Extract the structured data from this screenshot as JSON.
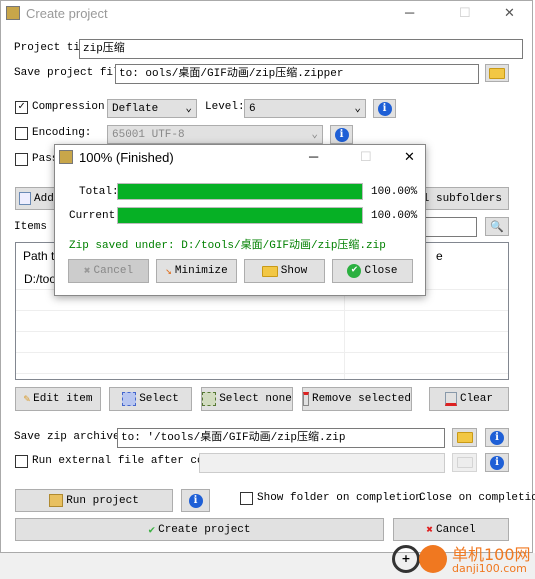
{
  "window": {
    "title": "Create project",
    "minimize": "─",
    "maximize": "☐",
    "close": "✕"
  },
  "form": {
    "project_title_label": "Project tit",
    "project_title_value": "zip压缩",
    "save_project_label": "Save project file",
    "save_project_value": "to: ools/桌面/GIF动画/zip压缩.zipper",
    "compression_label": "Compression:",
    "compression_checked": true,
    "compression_value": "Deflate",
    "level_label": "Level:",
    "level_value": "6",
    "encoding_label": "Encoding:",
    "encoding_checked": false,
    "encoding_value": "65001 UTF-8",
    "password_label": "Pass",
    "add_button": "Add",
    "subfolders_button": "l subfolders",
    "items_label": "Items i",
    "table": {
      "columns": [
        "Path to",
        "e"
      ],
      "rows": [
        [
          "D:/tool",
          ""
        ]
      ]
    },
    "edit_item": "Edit item",
    "select": "Select",
    "select_none": "Select none",
    "remove_selected": "Remove selected",
    "clear": "Clear",
    "save_zip_label": "Save zip archive",
    "save_zip_value": "to: '/tools/桌面/GIF动画/zip压缩.zip",
    "run_external_label": "Run external file after completion:",
    "run_external_checked": false,
    "run_project": "Run project",
    "show_folder_label": "Show folder on completion",
    "close_on_completion_label": "Close on completion",
    "create_project": "Create project",
    "cancel": "Cancel"
  },
  "dialog": {
    "title": "100% (Finished)",
    "minimize": "─",
    "maximize": "☐",
    "close": "✕",
    "total_label": "Total:",
    "total_percent": "100.00%",
    "total_progress": 100,
    "current_label": "Current:",
    "current_percent": "100.00%",
    "current_progress": 100,
    "message": "Zip saved under: D:/tools/桌面/GIF动画/zip压缩.zip",
    "cancel": "Cancel",
    "minimize_btn": "Minimize",
    "show": "Show",
    "close_btn": "Close"
  },
  "watermark": {
    "text": "单机100网",
    "url": "danji100.com"
  },
  "colors": {
    "progress": "#06b025",
    "message": "#008000"
  }
}
